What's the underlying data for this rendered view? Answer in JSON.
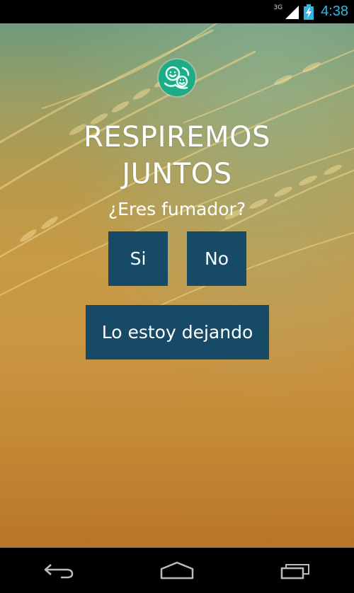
{
  "status_bar": {
    "network": "3G",
    "time": "4:38",
    "signal_icon": "signal-icon",
    "battery_icon": "battery-charging-icon"
  },
  "app": {
    "logo_icon": "smiley-faces-logo",
    "title_line1": "RESPIREMOS",
    "title_line2": "JUNTOS",
    "question": "¿Eres fumador?",
    "buttons": {
      "yes": "Si",
      "no": "No",
      "quitting": "Lo estoy dejando"
    },
    "colors": {
      "button_bg": "#174a66",
      "logo_bg": "#1dac88",
      "text": "#ffffff"
    }
  },
  "nav_bar": {
    "back_icon": "back-icon",
    "home_icon": "home-icon",
    "recents_icon": "recents-icon"
  }
}
